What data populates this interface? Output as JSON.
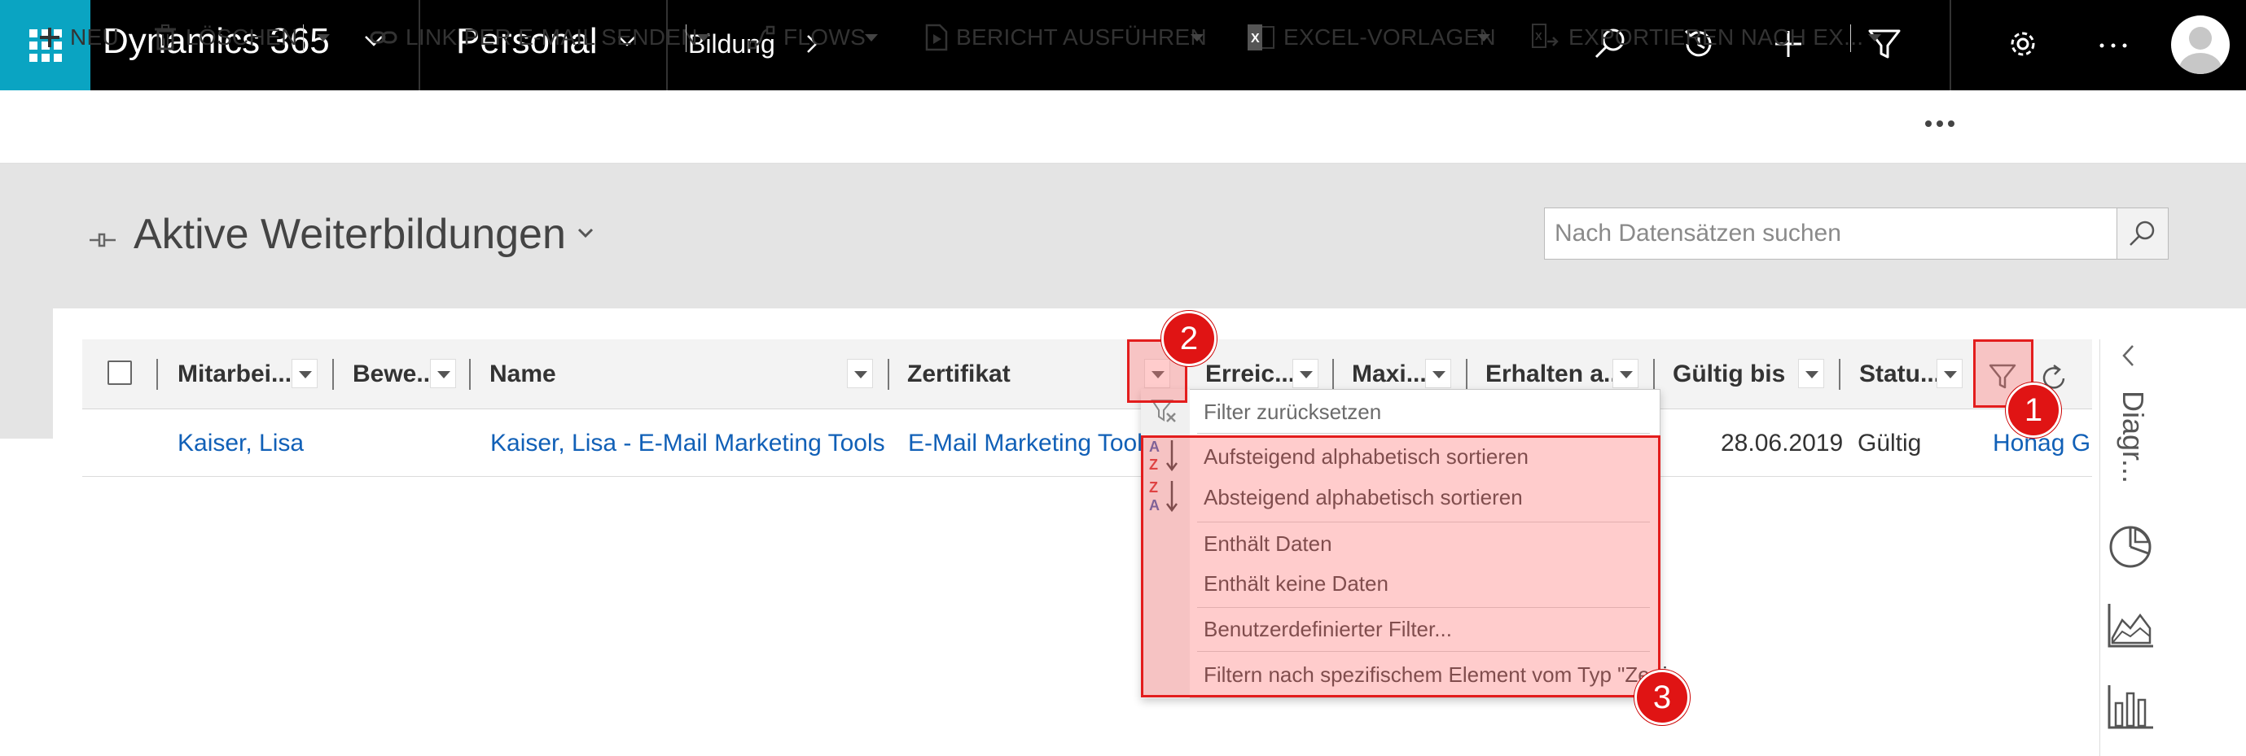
{
  "topbar": {
    "app_title": "Dynamics 365",
    "area_title": "Personal",
    "breadcrumb": "Bildung",
    "icons": [
      "search-icon",
      "history-icon",
      "plus-icon",
      "filter-icon",
      "gear-icon",
      "more-icon",
      "avatar"
    ],
    "brand_color": "#0aa4c2"
  },
  "commands": {
    "new": "NEU",
    "delete": "LÖSCHEN",
    "email_link": "LINK PER E-MAIL SENDEN",
    "flows": "FLOWS",
    "run_report": "BERICHT AUSFÜHREN",
    "excel_templates": "EXCEL-VORLAGEN",
    "export": "EXPORTIEREN NACH EX..."
  },
  "view": {
    "title": "Aktive Weiterbildungen"
  },
  "search": {
    "placeholder": "Nach Datensätzen suchen"
  },
  "grid": {
    "columns": [
      "Mitarbei...",
      "Bewe...",
      "Name",
      "Zertifikat",
      "Erreic...",
      "Maxi...",
      "Erhalten a...",
      "Gültig bis",
      "Statu..."
    ],
    "row": {
      "mitarbeiter": "Kaiser, Lisa",
      "name": "Kaiser, Lisa  - E-Mail Marketing Tools",
      "zertifikat": "E-Mail Marketing Tool",
      "gueltig_bis": "28.06.2019",
      "status": "Gültig",
      "extra": "Honag G"
    }
  },
  "side_panel": {
    "label": "Diagr..."
  },
  "menu": {
    "reset": "Filter zurücksetzen",
    "sort_asc": "Aufsteigend alphabetisch sortieren",
    "sort_desc": "Absteigend alphabetisch sortieren",
    "contains_data": "Enthält Daten",
    "contains_no_data": "Enthält keine Daten",
    "custom_filter": "Benutzerdefinierter Filter...",
    "filter_specific": "Filtern nach spezifischem Element vom Typ \"Zerti..."
  },
  "annotations": {
    "badge1": "1",
    "badge2": "2",
    "badge3": "3",
    "color": "#e01414"
  }
}
